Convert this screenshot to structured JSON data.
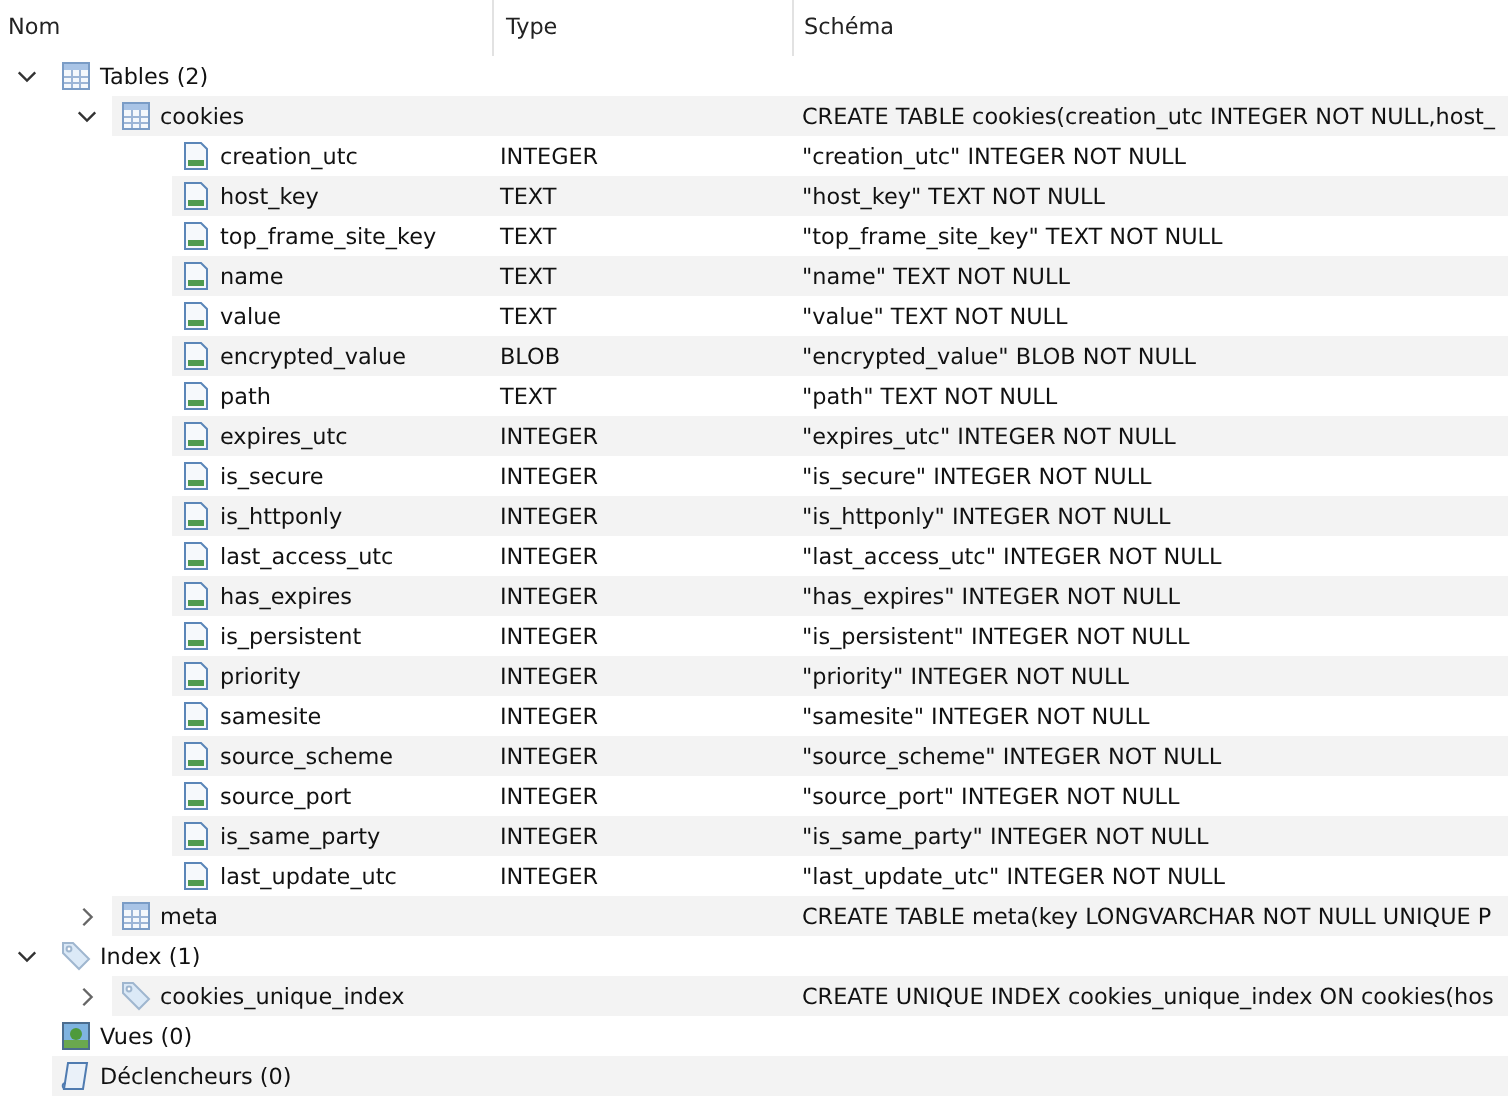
{
  "columns": [
    "Nom",
    "Type",
    "Schéma"
  ],
  "tree": [
    {
      "kind": "tables",
      "name": "Tables (2)",
      "expanded": true,
      "children": [
        {
          "kind": "table",
          "name": "cookies",
          "schema": "CREATE TABLE cookies(creation_utc INTEGER NOT NULL,host_",
          "expanded": true,
          "children": [
            {
              "kind": "column",
              "name": "creation_utc",
              "type": "INTEGER",
              "schema": "\"creation_utc\" INTEGER NOT NULL"
            },
            {
              "kind": "column",
              "name": "host_key",
              "type": "TEXT",
              "schema": "\"host_key\" TEXT NOT NULL"
            },
            {
              "kind": "column",
              "name": "top_frame_site_key",
              "type": "TEXT",
              "schema": "\"top_frame_site_key\" TEXT NOT NULL"
            },
            {
              "kind": "column",
              "name": "name",
              "type": "TEXT",
              "schema": "\"name\" TEXT NOT NULL"
            },
            {
              "kind": "column",
              "name": "value",
              "type": "TEXT",
              "schema": "\"value\" TEXT NOT NULL"
            },
            {
              "kind": "column",
              "name": "encrypted_value",
              "type": "BLOB",
              "schema": "\"encrypted_value\" BLOB NOT NULL"
            },
            {
              "kind": "column",
              "name": "path",
              "type": "TEXT",
              "schema": "\"path\" TEXT NOT NULL"
            },
            {
              "kind": "column",
              "name": "expires_utc",
              "type": "INTEGER",
              "schema": "\"expires_utc\" INTEGER NOT NULL"
            },
            {
              "kind": "column",
              "name": "is_secure",
              "type": "INTEGER",
              "schema": "\"is_secure\" INTEGER NOT NULL"
            },
            {
              "kind": "column",
              "name": "is_httponly",
              "type": "INTEGER",
              "schema": "\"is_httponly\" INTEGER NOT NULL"
            },
            {
              "kind": "column",
              "name": "last_access_utc",
              "type": "INTEGER",
              "schema": "\"last_access_utc\" INTEGER NOT NULL"
            },
            {
              "kind": "column",
              "name": "has_expires",
              "type": "INTEGER",
              "schema": "\"has_expires\" INTEGER NOT NULL"
            },
            {
              "kind": "column",
              "name": "is_persistent",
              "type": "INTEGER",
              "schema": "\"is_persistent\" INTEGER NOT NULL"
            },
            {
              "kind": "column",
              "name": "priority",
              "type": "INTEGER",
              "schema": "\"priority\" INTEGER NOT NULL"
            },
            {
              "kind": "column",
              "name": "samesite",
              "type": "INTEGER",
              "schema": "\"samesite\" INTEGER NOT NULL"
            },
            {
              "kind": "column",
              "name": "source_scheme",
              "type": "INTEGER",
              "schema": "\"source_scheme\" INTEGER NOT NULL"
            },
            {
              "kind": "column",
              "name": "source_port",
              "type": "INTEGER",
              "schema": "\"source_port\" INTEGER NOT NULL"
            },
            {
              "kind": "column",
              "name": "is_same_party",
              "type": "INTEGER",
              "schema": "\"is_same_party\" INTEGER NOT NULL"
            },
            {
              "kind": "column",
              "name": "last_update_utc",
              "type": "INTEGER",
              "schema": "\"last_update_utc\" INTEGER NOT NULL"
            }
          ]
        },
        {
          "kind": "table",
          "name": "meta",
          "schema": "CREATE TABLE meta(key LONGVARCHAR NOT NULL UNIQUE P",
          "expanded": false
        }
      ]
    },
    {
      "kind": "indexes",
      "name": "Index (1)",
      "expanded": true,
      "children": [
        {
          "kind": "index",
          "name": "cookies_unique_index",
          "schema": "CREATE UNIQUE INDEX cookies_unique_index ON cookies(hos",
          "expanded": false
        }
      ]
    },
    {
      "kind": "views",
      "name": "Vues (0)"
    },
    {
      "kind": "triggers",
      "name": "Déclencheurs (0)"
    }
  ]
}
